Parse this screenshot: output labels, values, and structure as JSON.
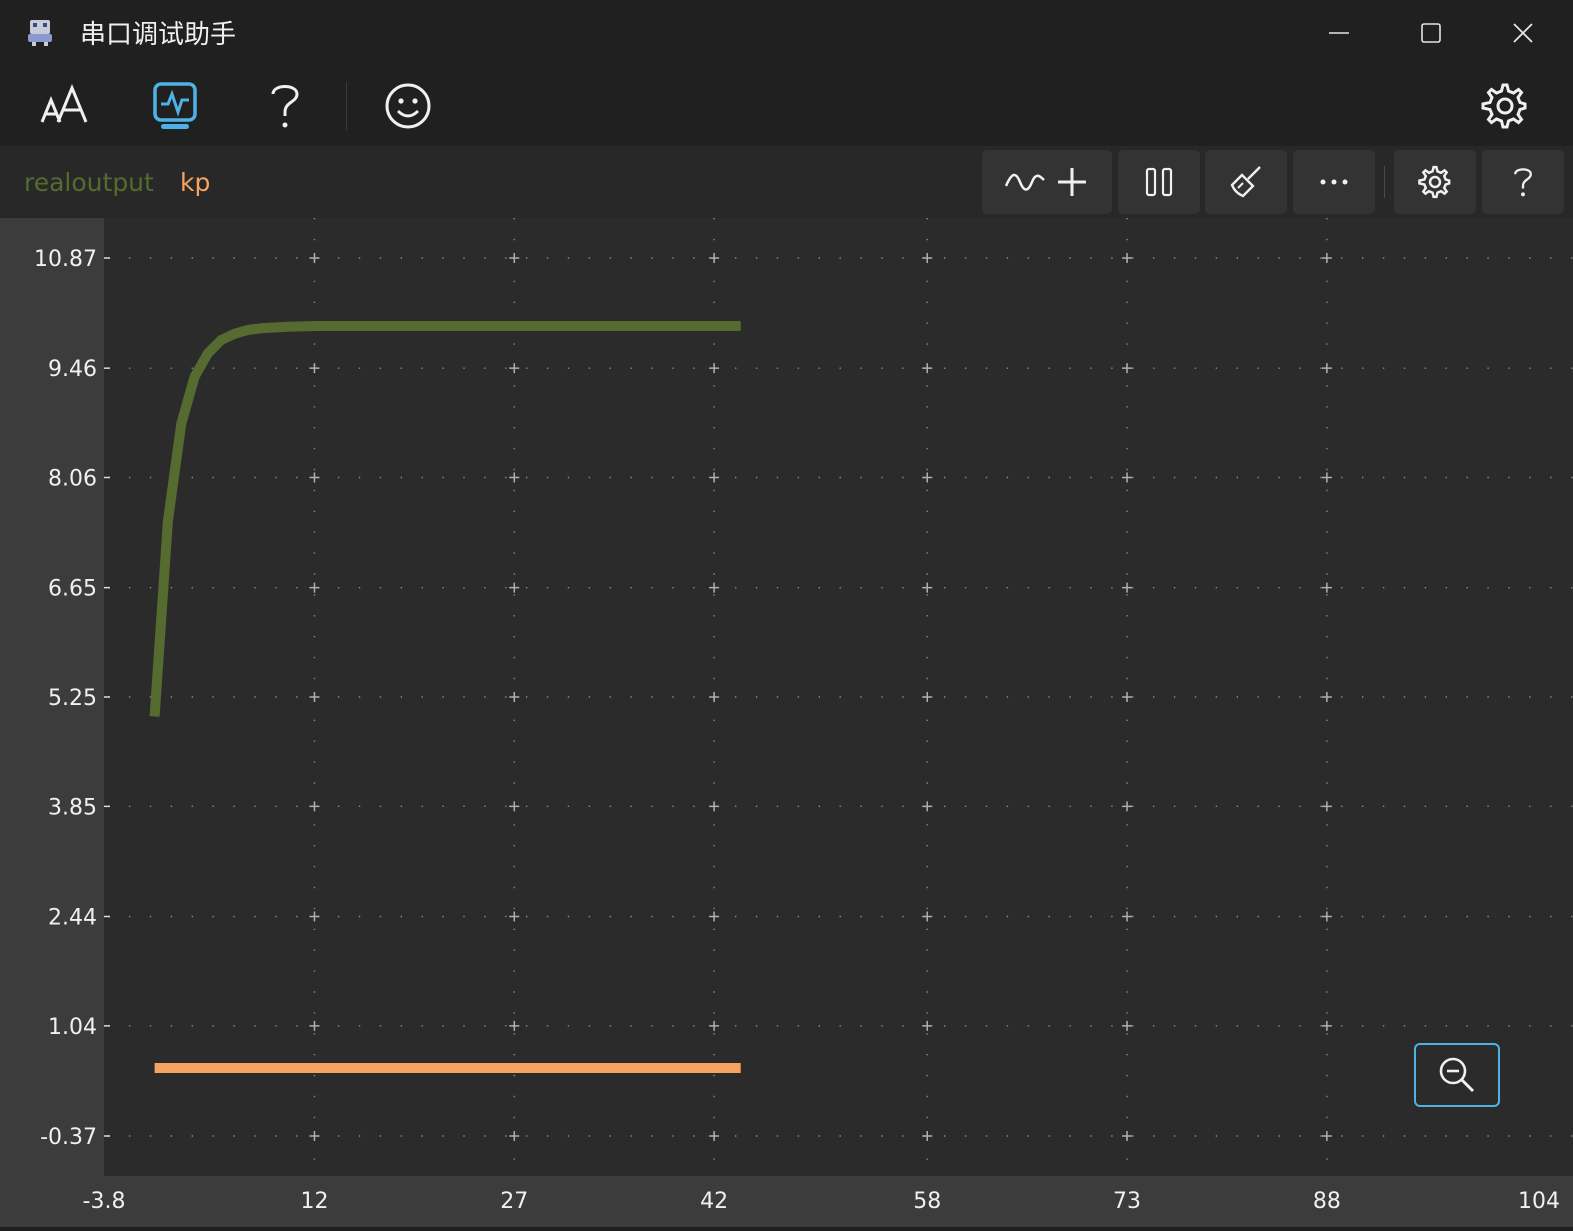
{
  "window": {
    "title": "串口调试助手"
  },
  "icons": {
    "app": "robot-app-icon",
    "minimize": "minimize-icon",
    "maximize": "maximize-icon",
    "close": "close-icon",
    "font_size": "font-size-icon",
    "oscilloscope": "oscilloscope-icon",
    "help": "help-icon",
    "smiley": "smiley-icon",
    "settings": "gear-icon",
    "add_wave": "add-waveform-icon",
    "pause": "pause-icon",
    "clear": "broom-icon",
    "more": "more-icon",
    "plot_settings": "gear-icon",
    "plot_help": "help-icon",
    "zoom_out": "zoom-out-icon"
  },
  "colors": {
    "accent": "#4db3e6",
    "realoutput": "#556b2f",
    "kp": "#f4a460",
    "plot_bg": "#2b2b2b",
    "axis_bg": "#3c3c3c"
  },
  "legend": [
    {
      "label": "realoutput"
    },
    {
      "label": "kp"
    }
  ],
  "chart_data": {
    "type": "line",
    "xlim": [
      -3.8,
      104
    ],
    "ylim": [
      -0.37,
      10.87
    ],
    "x_ticks": [
      "-3.8",
      "12",
      "27",
      "42",
      "58",
      "73",
      "88",
      "104"
    ],
    "y_ticks": [
      "10.87",
      "9.46",
      "8.06",
      "6.65",
      "5.25",
      "3.85",
      "2.44",
      "1.04",
      "-0.37"
    ],
    "grid": true,
    "series": [
      {
        "name": "realoutput",
        "color": "#556b2f",
        "x": [
          0,
          1,
          2,
          3,
          4,
          5,
          6,
          7,
          8,
          9,
          10,
          12,
          14,
          17,
          20,
          25,
          30,
          35,
          40,
          44
        ],
        "y": [
          5.0,
          7.5,
          8.75,
          9.35,
          9.65,
          9.82,
          9.9,
          9.95,
          9.97,
          9.98,
          9.99,
          10.0,
          10.0,
          10.0,
          10.0,
          10.0,
          10.0,
          10.0,
          10.0,
          10.0
        ]
      },
      {
        "name": "kp",
        "color": "#f4a460",
        "x": [
          0,
          44
        ],
        "y": [
          0.5,
          0.5
        ]
      }
    ]
  }
}
